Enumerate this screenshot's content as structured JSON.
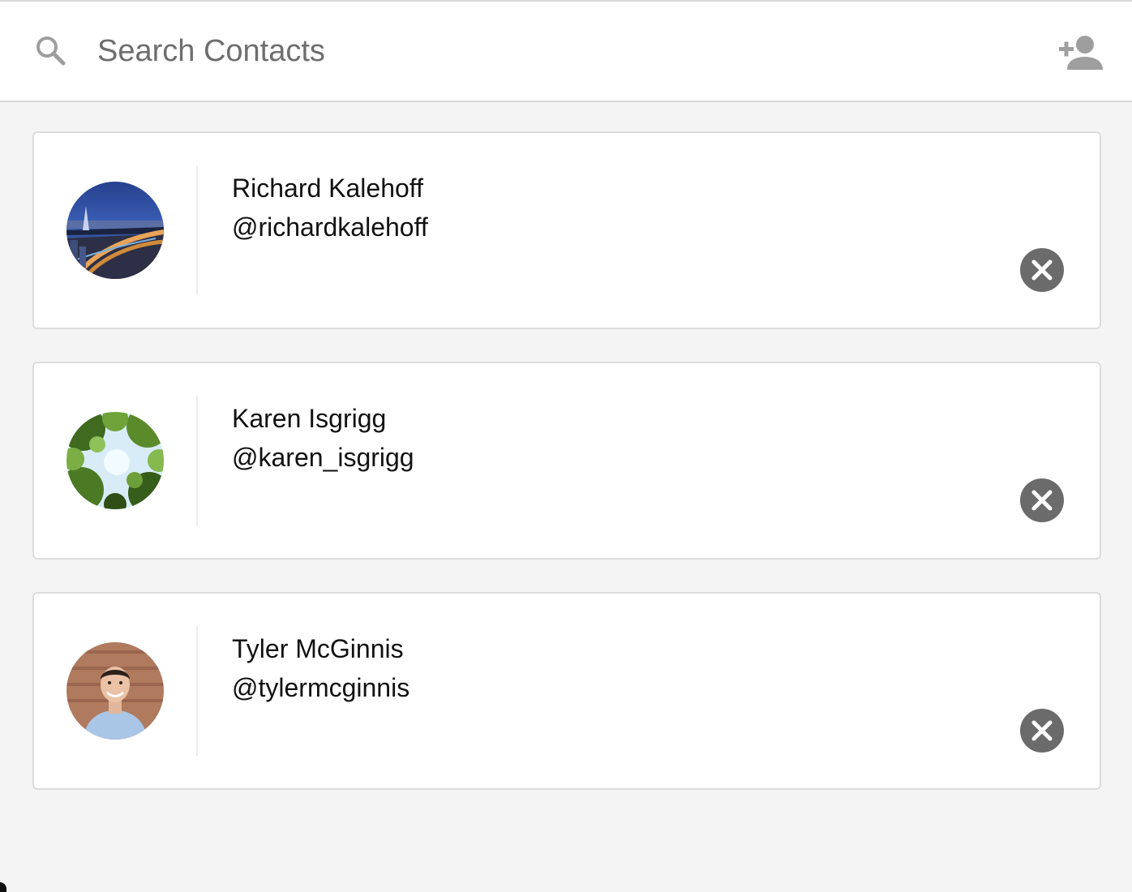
{
  "search": {
    "placeholder": "Search Contacts",
    "value": ""
  },
  "icons": {
    "search": "search-icon",
    "add_contact": "person-add-icon",
    "remove": "close-circle-icon"
  },
  "colors": {
    "icon_gray": "#9e9e9e",
    "remove_button": "#6b6b6b",
    "card_border": "#dcdcdc",
    "background": "#f4f4f4"
  },
  "contacts": [
    {
      "name": "Richard Kalehoff",
      "handle": "@richardkalehoff"
    },
    {
      "name": "Karen Isgrigg",
      "handle": "@karen_isgrigg"
    },
    {
      "name": "Tyler McGinnis",
      "handle": "@tylermcginnis"
    }
  ]
}
